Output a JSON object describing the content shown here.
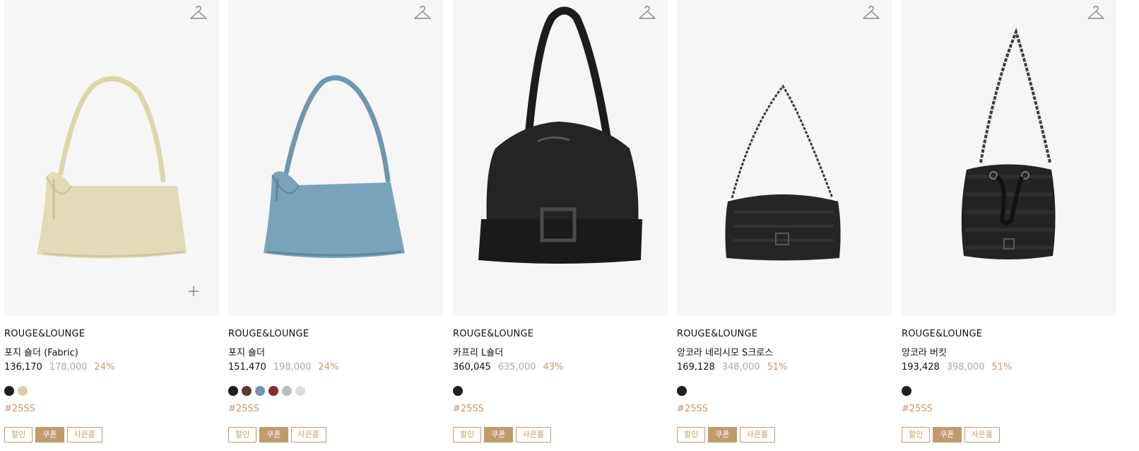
{
  "products": [
    {
      "brand": "ROUGE&LOUNGE",
      "name": "포지 숄더 (Fabric)",
      "sale_price": "136,170",
      "original_price": "178,000",
      "discount": "24%",
      "colors": [
        "#1f1f1f",
        "#d8cfa6"
      ],
      "tag": "#25SS",
      "badges": [
        "할인",
        "쿠폰",
        "사은품"
      ],
      "image": "cream hobo shoulder bag"
    },
    {
      "brand": "ROUGE&LOUNGE",
      "name": "포지 숄더",
      "sale_price": "151,470",
      "original_price": "198,000",
      "discount": "24%",
      "colors": [
        "#1f1f1f",
        "#5a3b2c",
        "#6f97ad",
        "#8b2a2e",
        "#bdbdbd",
        "#dcdcdc"
      ],
      "tag": "#25SS",
      "badges": [
        "할인",
        "쿠폰",
        "사은품"
      ],
      "image": "blue hobo shoulder bag"
    },
    {
      "brand": "ROUGE&LOUNGE",
      "name": "카프리 L숄더",
      "sale_price": "360,045",
      "original_price": "635,000",
      "discount": "43%",
      "colors": [
        "#1f1f1f"
      ],
      "tag": "#25SS",
      "badges": [
        "할인",
        "쿠폰",
        "사은품"
      ],
      "image": "black leather shoulder tote"
    },
    {
      "brand": "ROUGE&LOUNGE",
      "name": "앙코라 네리시모 S크로스",
      "sale_price": "169,128",
      "original_price": "348,000",
      "discount": "51%",
      "colors": [
        "#1f1f1f"
      ],
      "tag": "#25SS",
      "badges": [
        "할인",
        "쿠폰",
        "사은품"
      ],
      "image": "black woven chain crossbody bag"
    },
    {
      "brand": "ROUGE&LOUNGE",
      "name": "앙코라 버킷",
      "sale_price": "193,428",
      "original_price": "398,000",
      "discount": "51%",
      "colors": [
        "#1f1f1f"
      ],
      "tag": "#25SS",
      "badges": [
        "할인",
        "쿠폰",
        "사은품"
      ],
      "image": "black woven chain bucket bag"
    }
  ],
  "icons": {
    "wishlist": "hanger-icon",
    "quick_add": "plus-icon"
  },
  "accent_color": "#c29a6c"
}
